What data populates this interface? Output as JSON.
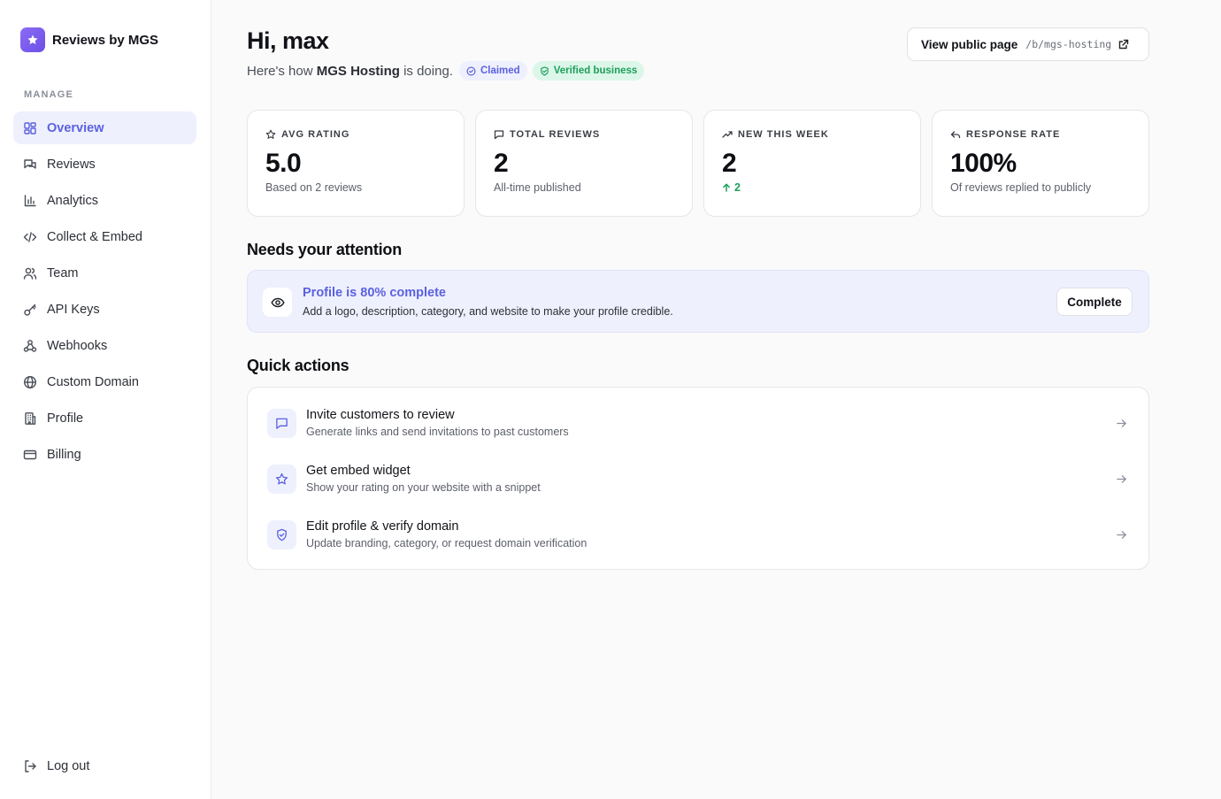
{
  "brand": {
    "name": "Reviews by MGS"
  },
  "sidebar": {
    "section_label": "MANAGE",
    "items": [
      {
        "label": "Overview",
        "icon": "dashboard-icon",
        "active": true
      },
      {
        "label": "Reviews",
        "icon": "chat-bubbles-icon"
      },
      {
        "label": "Analytics",
        "icon": "bar-chart-icon"
      },
      {
        "label": "Collect & Embed",
        "icon": "code-icon"
      },
      {
        "label": "Team",
        "icon": "users-icon"
      },
      {
        "label": "API Keys",
        "icon": "key-icon"
      },
      {
        "label": "Webhooks",
        "icon": "webhook-icon"
      },
      {
        "label": "Custom Domain",
        "icon": "globe-icon"
      },
      {
        "label": "Profile",
        "icon": "building-icon"
      },
      {
        "label": "Billing",
        "icon": "credit-card-icon"
      }
    ],
    "logout_label": "Log out"
  },
  "header": {
    "greeting": "Hi, max",
    "sub_prefix": "Here's how",
    "business_name": "MGS Hosting",
    "sub_suffix": "is doing.",
    "badge_claimed": "Claimed",
    "badge_verified": "Verified business",
    "public_page_label": "View public page",
    "public_page_path": "/b/mgs-hosting"
  },
  "stats": [
    {
      "label": "AVG RATING",
      "icon": "star-icon",
      "value": "5.0",
      "sub": "Based on 2 reviews"
    },
    {
      "label": "TOTAL REVIEWS",
      "icon": "message-icon",
      "value": "2",
      "sub": "All-time published"
    },
    {
      "label": "NEW THIS WEEK",
      "icon": "trending-up-icon",
      "value": "2",
      "sub": "2",
      "sub_trend": "up"
    },
    {
      "label": "RESPONSE RATE",
      "icon": "reply-icon",
      "value": "100%",
      "sub": "Of reviews replied to publicly"
    }
  ],
  "attention": {
    "heading": "Needs your attention",
    "title": "Profile is 80% complete",
    "description": "Add a logo, description, category, and website to make your profile credible.",
    "button": "Complete"
  },
  "quick_actions": {
    "heading": "Quick actions",
    "items": [
      {
        "title": "Invite customers to review",
        "desc": "Generate links and send invitations to past customers",
        "icon": "message-icon"
      },
      {
        "title": "Get embed widget",
        "desc": "Show your rating on your website with a snippet",
        "icon": "star-icon"
      },
      {
        "title": "Edit profile & verify domain",
        "desc": "Update branding, category, or request domain verification",
        "icon": "shield-check-icon"
      }
    ]
  },
  "colors": {
    "accent": "#5b61e0",
    "accent_bg": "#eef0fd",
    "success": "#1ea05e",
    "success_bg": "#dcf7e9",
    "brand_gradient_start": "#8b6cf6",
    "brand_gradient_end": "#6d4fe6"
  }
}
